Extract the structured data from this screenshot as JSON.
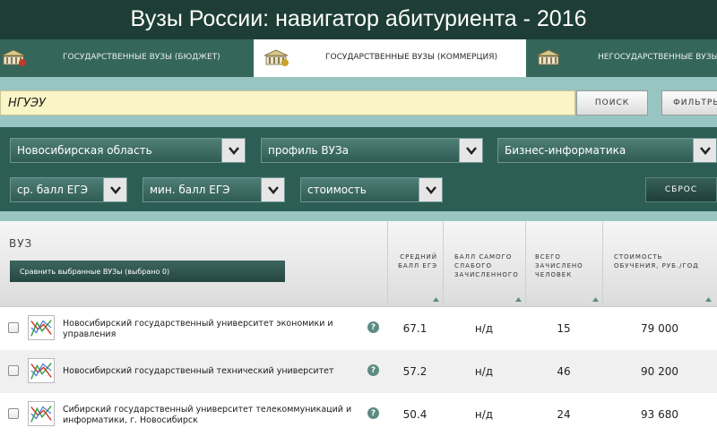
{
  "banner": {
    "title": "Вузы России: навигатор абитуриента - 2016"
  },
  "tabs": [
    {
      "label": "Государственные вузы (бюджет)"
    },
    {
      "label": "Государственные вузы (коммерция)"
    },
    {
      "label": "Негосударственные вузы"
    }
  ],
  "search": {
    "value": "НГУЭУ",
    "button_label": "Поиск",
    "filters_label": "Фильтры"
  },
  "filters": {
    "region": "Новосибирская область",
    "profile": "профиль ВУЗа",
    "specialty": "Бизнес-информатика",
    "avg_score": "ср. балл ЕГЭ",
    "min_score": "мин. балл ЕГЭ",
    "cost": "стоимость",
    "reset_label": "Сброс"
  },
  "table": {
    "vuz_header": "ВУЗ",
    "compare_button": "Сравнить выбранные ВУЗы (выбрано 0)",
    "columns": [
      "Средний\nбалл ЕГЭ",
      "Балл самого\nслабого\nзачисленного",
      "Всего\nзачислено\nчеловек",
      "Стоимость\nобучения, руб./год"
    ],
    "rows": [
      {
        "name": "Новосибирский государственный университет экономики и управления",
        "avg_score": "67.1",
        "min_score": "н/д",
        "enrolled": "15",
        "cost": "79 000"
      },
      {
        "name": "Новосибирский государственный технический университет",
        "avg_score": "57.2",
        "min_score": "н/д",
        "enrolled": "46",
        "cost": "90 200"
      },
      {
        "name": "Сибирский государственный университет телекоммуникаций и информатики, г. Новосибирск",
        "avg_score": "50.4",
        "min_score": "н/д",
        "enrolled": "24",
        "cost": "93 680"
      }
    ],
    "help_glyph": "?"
  },
  "icons": {
    "tab_icon": "university-building-icon",
    "row_icon": "line-chart-icon",
    "help_icon": "question-circle-icon",
    "dropdown_icon": "chevron-down-icon",
    "sort_icon": "sort-up-icon"
  },
  "colors": {
    "banner": "#1e3e35",
    "tabs": "#35665a",
    "search_band": "#98c5c2",
    "search_input": "#f9f5c6",
    "filters_panel": "#2c5e56"
  }
}
